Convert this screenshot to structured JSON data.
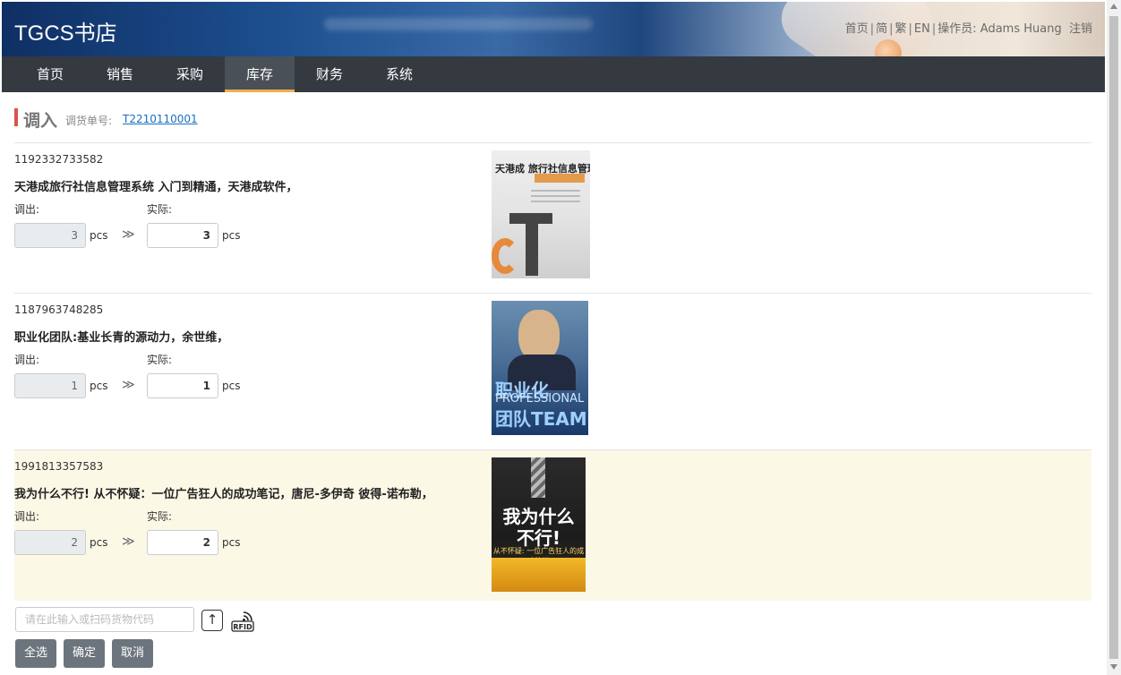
{
  "header": {
    "brand": "TGCS书店",
    "links": {
      "home": "首页",
      "simplified": "简",
      "traditional": "繁",
      "english": "EN",
      "operator_label": "操作员:",
      "operator_name": "Adams Huang",
      "logout": "注销"
    }
  },
  "nav": {
    "items": [
      "首页",
      "销售",
      "采购",
      "库存",
      "财务",
      "系统"
    ],
    "active": "库存"
  },
  "page": {
    "title": "调入",
    "doc_label": "调货单号:",
    "doc_no": "T2210110001"
  },
  "items": [
    {
      "code": "1192332733582",
      "name": "天港成旅行社信息管理系统 入门到精通，天港成软件，",
      "out_label": "调出:",
      "actual_label": "实际:",
      "out_qty": "3",
      "actual_qty": "3",
      "unit": "pcs",
      "arrow": "≫",
      "cover_text": "天港成 旅行社信息管理系统"
    },
    {
      "code": "1187963748285",
      "name": "职业化团队:基业长青的源动力，余世维，",
      "out_label": "调出:",
      "actual_label": "实际:",
      "out_qty": "1",
      "actual_qty": "1",
      "unit": "pcs",
      "arrow": "≫",
      "cover_text": "职业化",
      "cover_text2": "PROFESSIONAL",
      "cover_text3": "团队TEAM"
    },
    {
      "code": "1991813357583",
      "name": "我为什么不行! 从不怀疑：一位广告狂人的成功笔记，唐尼-多伊奇 彼得-诺布勒，",
      "out_label": "调出:",
      "actual_label": "实际:",
      "out_qty": "2",
      "actual_qty": "2",
      "unit": "pcs",
      "arrow": "≫",
      "cover_text": "我为什么",
      "cover_text2": "不行!",
      "cover_text3": "从不怀疑: 一位广告狂人的成功笔记"
    }
  ],
  "footer": {
    "scan_placeholder": "请在此输入或扫码货物代码",
    "upload_icon": "↑",
    "rfid_label": "RFID",
    "buttons": {
      "select_all": "全选",
      "confirm": "确定",
      "cancel": "取消"
    }
  },
  "colors": {
    "nav_bg": "#343a40",
    "active_underline": "#f0ad4e",
    "title_marker": "#d9534f",
    "highlight_row": "#fcf8e6",
    "button_bg": "#6c757d",
    "link": "#1a6fc0"
  }
}
